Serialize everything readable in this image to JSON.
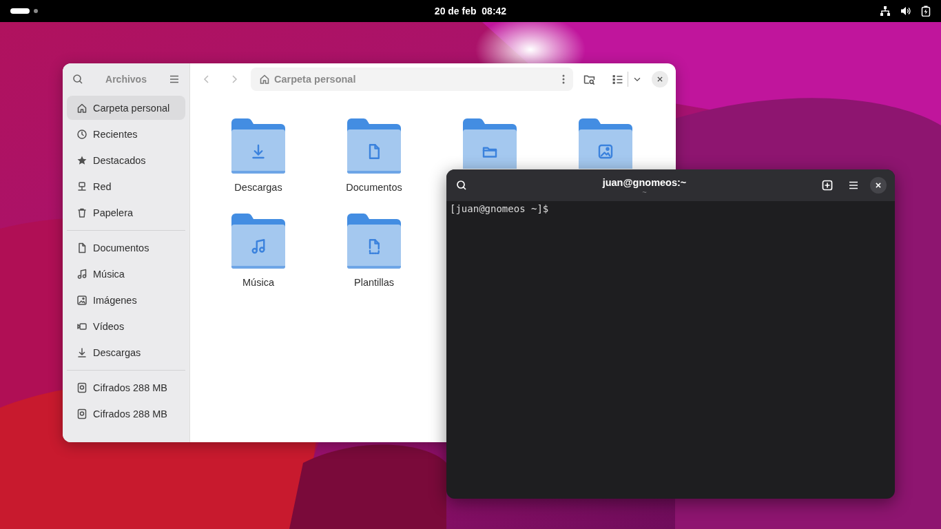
{
  "top_bar": {
    "date": "20 de feb",
    "time": "08:42"
  },
  "files_window": {
    "title": "Archivos",
    "location": "Carpeta personal",
    "sidebar": [
      {
        "items": [
          {
            "label": "Carpeta personal",
            "selected": true
          },
          {
            "label": "Recientes",
            "selected": false
          },
          {
            "label": "Destacados",
            "selected": false
          },
          {
            "label": "Red",
            "selected": false
          },
          {
            "label": "Papelera",
            "selected": false
          }
        ]
      },
      {
        "items": [
          {
            "label": "Documentos",
            "selected": false
          },
          {
            "label": "Música",
            "selected": false
          },
          {
            "label": "Imágenes",
            "selected": false
          },
          {
            "label": "Vídeos",
            "selected": false
          },
          {
            "label": "Descargas",
            "selected": false
          }
        ]
      },
      {
        "items": [
          {
            "label": "Cifrados 288 MB",
            "selected": false
          },
          {
            "label": "Cifrados 288 MB",
            "selected": false
          }
        ]
      }
    ],
    "folders": [
      {
        "name": "Descargas"
      },
      {
        "name": "Documentos"
      },
      {
        "kind": "covered"
      },
      {
        "kind": "covered"
      },
      {
        "name": "Música"
      },
      {
        "name": "Plantillas"
      }
    ]
  },
  "terminal": {
    "title": "juan@gnomeos:~",
    "subtitle": "~",
    "prompt": "[juan@gnomeos ~]$"
  }
}
